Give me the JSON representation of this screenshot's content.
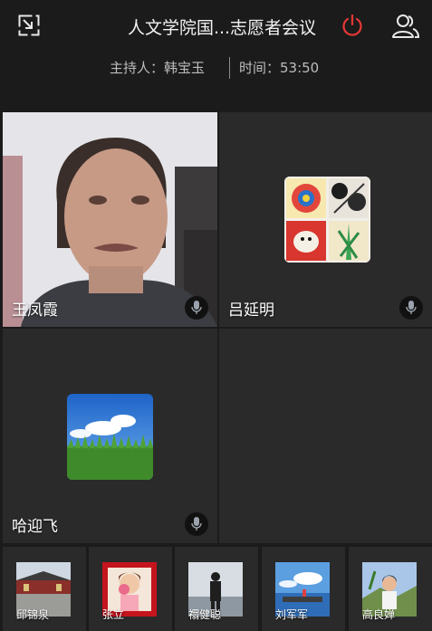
{
  "header": {
    "title": "人文学院国...志愿者会议",
    "host": "主持人：韩宝玉",
    "time": "时间：53:50"
  },
  "participants": [
    {
      "name": "王凤霞"
    },
    {
      "name": "吕延明"
    },
    {
      "name": "哈迎飞"
    }
  ],
  "thumbnails": [
    {
      "name": "邱锦泉"
    },
    {
      "name": "张立"
    },
    {
      "name": "禤健聪"
    },
    {
      "name": "刘军军"
    },
    {
      "name": "高良婵"
    }
  ],
  "colors": {
    "background": "#1b1b1b",
    "tile": "#2a2a2a",
    "power_red": "#e53935"
  },
  "icons": [
    "minimize-icon",
    "power-icon",
    "participants-icon",
    "microphone-icon"
  ]
}
